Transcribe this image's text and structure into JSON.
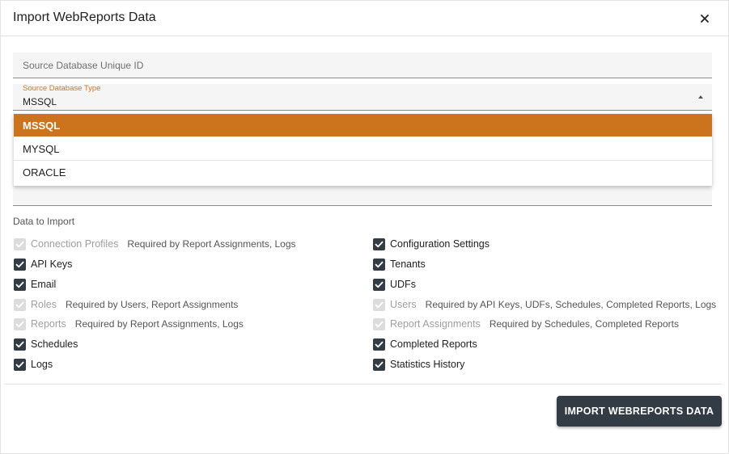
{
  "dialog": {
    "title": "Import WebReports Data",
    "close_icon": "close-icon"
  },
  "fields": {
    "unique_id_placeholder": "Source Database Unique ID",
    "db_type_label": "Source Database Type",
    "db_type_value": "MSSQL"
  },
  "dropdown": {
    "options": [
      {
        "label": "MSSQL",
        "selected": true
      },
      {
        "label": "MYSQL",
        "selected": false
      },
      {
        "label": "ORACLE",
        "selected": false
      }
    ]
  },
  "section_label": "Data to Import",
  "checkboxes": {
    "left": [
      {
        "label": "Connection Profiles",
        "checked": true,
        "disabled": true,
        "hint": "Required by Report Assignments, Logs"
      },
      {
        "label": "API Keys",
        "checked": true,
        "disabled": false,
        "hint": ""
      },
      {
        "label": "Email",
        "checked": true,
        "disabled": false,
        "hint": ""
      },
      {
        "label": "Roles",
        "checked": true,
        "disabled": true,
        "hint": "Required by Users, Report Assignments"
      },
      {
        "label": "Reports",
        "checked": true,
        "disabled": true,
        "hint": "Required by Report Assignments, Logs"
      },
      {
        "label": "Schedules",
        "checked": true,
        "disabled": false,
        "hint": ""
      },
      {
        "label": "Logs",
        "checked": true,
        "disabled": false,
        "hint": ""
      }
    ],
    "right": [
      {
        "label": "Configuration Settings",
        "checked": true,
        "disabled": false,
        "hint": ""
      },
      {
        "label": "Tenants",
        "checked": true,
        "disabled": false,
        "hint": ""
      },
      {
        "label": "UDFs",
        "checked": true,
        "disabled": false,
        "hint": ""
      },
      {
        "label": "Users",
        "checked": true,
        "disabled": true,
        "hint": "Required by API Keys, UDFs, Schedules, Completed Reports, Logs"
      },
      {
        "label": "Report Assignments",
        "checked": true,
        "disabled": true,
        "hint": "Required by Schedules, Completed Reports"
      },
      {
        "label": "Completed Reports",
        "checked": true,
        "disabled": false,
        "hint": ""
      },
      {
        "label": "Statistics History",
        "checked": true,
        "disabled": false,
        "hint": ""
      }
    ]
  },
  "footer": {
    "import_button": "IMPORT WEBREPORTS DATA"
  },
  "colors": {
    "accent": "#cc731e",
    "checkbox": "#333b44",
    "button": "#333b44",
    "disabled": "#dcdcdc"
  }
}
